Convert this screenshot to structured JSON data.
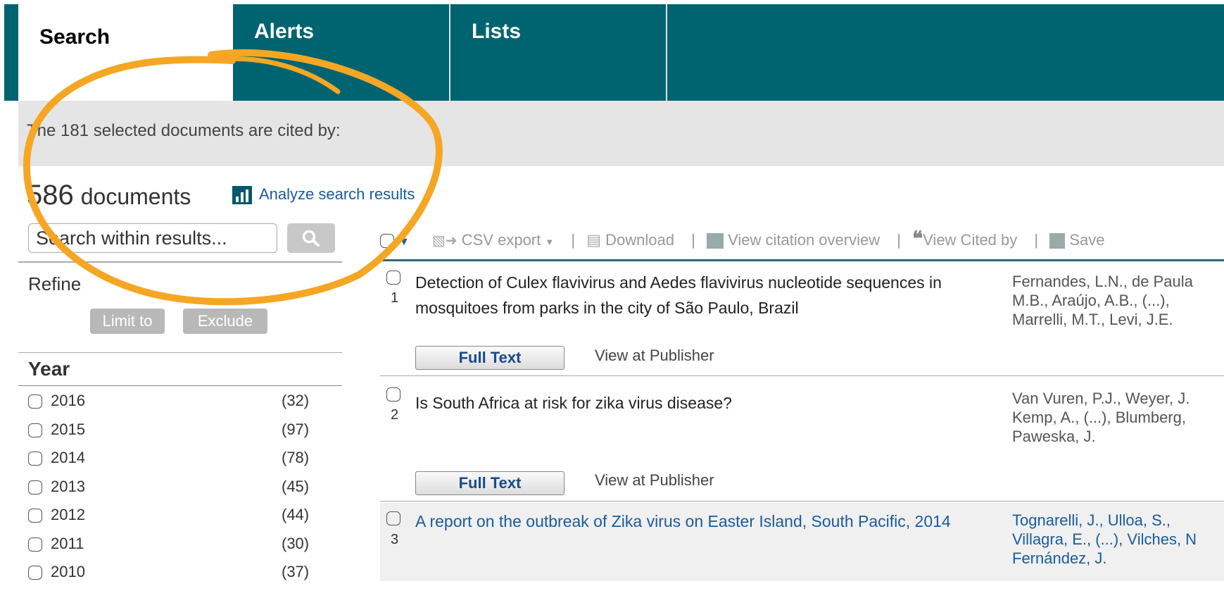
{
  "tabs": [
    {
      "label": "Search"
    },
    {
      "label": "Alerts"
    },
    {
      "label": "Lists"
    }
  ],
  "cited_text": "The 181 selected documents are cited by:",
  "doc_count": {
    "number": "586",
    "label": "documents"
  },
  "analyze_label": "Analyze search results",
  "search": {
    "placeholder": "Search within results..."
  },
  "refine": {
    "title": "Refine",
    "limit_label": "Limit to",
    "exclude_label": "Exclude"
  },
  "year": {
    "title": "Year",
    "items": [
      {
        "year": "2016",
        "count": "(32)"
      },
      {
        "year": "2015",
        "count": "(97)"
      },
      {
        "year": "2014",
        "count": "(78)"
      },
      {
        "year": "2013",
        "count": "(45)"
      },
      {
        "year": "2012",
        "count": "(44)"
      },
      {
        "year": "2011",
        "count": "(30)"
      },
      {
        "year": "2010",
        "count": "(37)"
      }
    ]
  },
  "toolbar": {
    "csv": "CSV export",
    "download": "Download",
    "citation": "View citation overview",
    "citedby": "View Cited by",
    "save": "Save"
  },
  "results": [
    {
      "num": "1",
      "title": "Detection of Culex flavivirus and Aedes flavivirus nucleotide sequences in mosquitoes from parks in the city of São Paulo, Brazil",
      "authors": [
        "Fernandes, L.N., de Paula",
        "M.B., Araújo, A.B., (...),",
        "Marrelli, M.T., Levi, J.E."
      ]
    },
    {
      "num": "2",
      "title": "Is South Africa at risk for zika virus disease?",
      "authors": [
        "Van Vuren, P.J., Weyer, J.",
        "Kemp, A., (...), Blumberg,",
        "Paweska, J."
      ]
    },
    {
      "num": "3",
      "title": "A report on the outbreak of Zika virus on Easter Island, South Pacific, 2014",
      "authors": [
        "Tognarelli, J., Ulloa, S.,",
        "Villagra, E., (...), Vilches, N",
        "Fernández, J."
      ]
    }
  ],
  "buttons": {
    "fulltext": "Full Text",
    "publisher": "View at Publisher"
  }
}
